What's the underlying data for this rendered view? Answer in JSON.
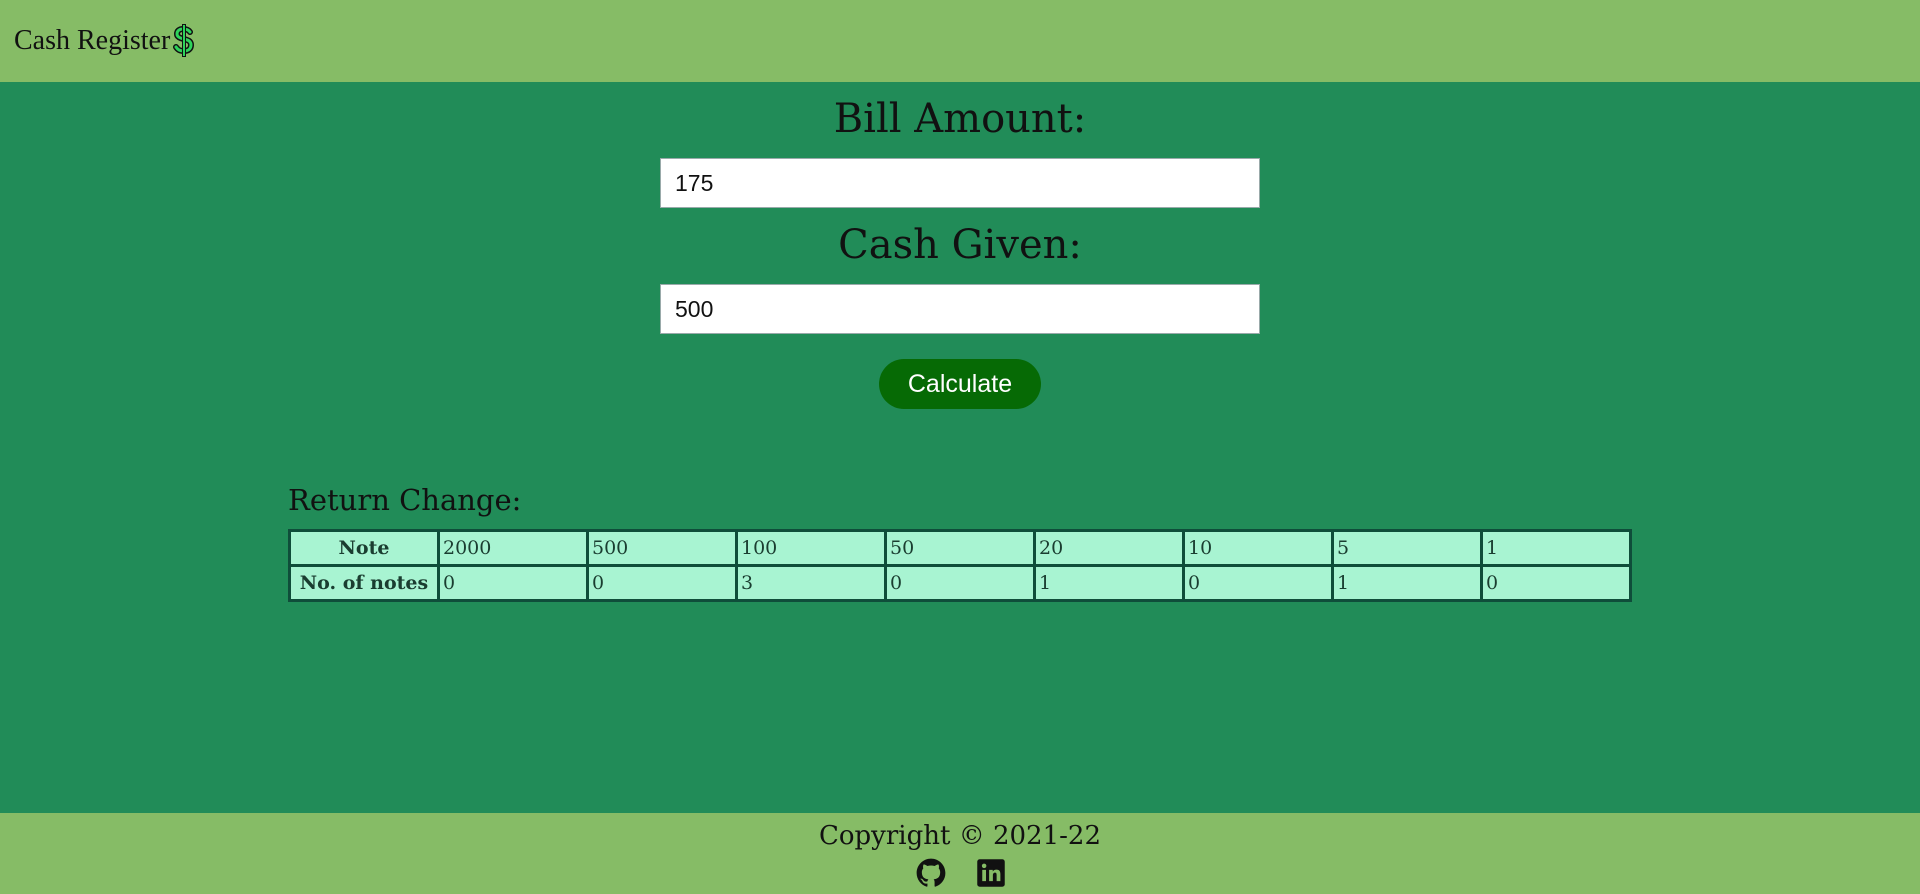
{
  "header": {
    "title": "Cash Register",
    "logo_icon": "dollar-icon"
  },
  "form": {
    "bill_label": "Bill Amount:",
    "bill_value": "175",
    "cash_label": "Cash Given:",
    "cash_value": "500",
    "button_label": "Calculate"
  },
  "change": {
    "title": "Return Change:",
    "row_headers": [
      "Note",
      "No. of notes"
    ],
    "notes": [
      "2000",
      "500",
      "100",
      "50",
      "20",
      "10",
      "5",
      "1"
    ],
    "counts": [
      "0",
      "0",
      "3",
      "0",
      "1",
      "0",
      "1",
      "0"
    ]
  },
  "footer": {
    "copyright": "Copyright © 2021-22",
    "links": [
      {
        "icon": "github-icon"
      },
      {
        "icon": "linkedin-icon"
      }
    ]
  },
  "colors": {
    "header_bg": "#86bc66",
    "main_bg": "#218c58",
    "button_bg": "#066a05",
    "table_bg": "#a8f4d2",
    "table_border": "#0f4d3a"
  }
}
